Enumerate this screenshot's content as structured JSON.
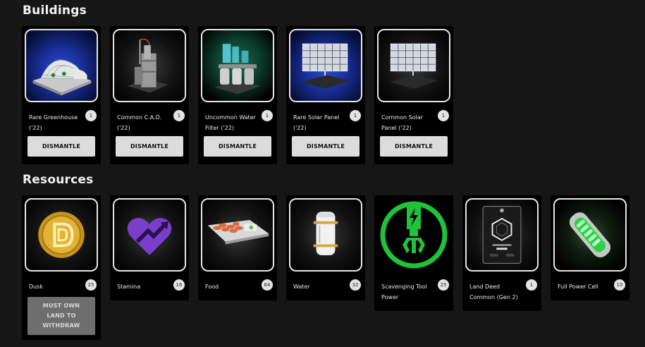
{
  "sections": {
    "buildings_title": "Buildings",
    "resources_title": "Resources"
  },
  "buildings": [
    {
      "name": "Rare Greenhouse ('22)",
      "count": "1",
      "action": "DISMANTLE",
      "icon": "greenhouse-icon"
    },
    {
      "name": "Common C.A.D. ('22)",
      "count": "1",
      "action": "DISMANTLE",
      "icon": "cad-tower-icon"
    },
    {
      "name": "Uncommon Water Filter ('22)",
      "count": "1",
      "action": "DISMANTLE",
      "icon": "water-filter-icon"
    },
    {
      "name": "Rare Solar Panel ('22)",
      "count": "1",
      "action": "DISMANTLE",
      "icon": "solar-panel-icon"
    },
    {
      "name": "Common Solar Panel ('22)",
      "count": "1",
      "action": "DISMANTLE",
      "icon": "solar-panel-icon"
    }
  ],
  "resources": [
    {
      "name": "Dusk",
      "count": "25",
      "action": "MUST OWN LAND TO WITHDRAW",
      "icon": "dusk-coin-icon"
    },
    {
      "name": "Stamina",
      "count": "16",
      "icon": "stamina-heart-icon"
    },
    {
      "name": "Food",
      "count": "64",
      "icon": "food-tray-icon"
    },
    {
      "name": "Water",
      "count": "32",
      "icon": "water-canister-icon"
    },
    {
      "name": "Scavenging Tool Power",
      "count": "25",
      "icon": "scavenging-claw-icon"
    },
    {
      "name": "Land Deed Common (Gen 2)",
      "count": "1",
      "icon": "land-deed-icon"
    },
    {
      "name": "Full Power Cell",
      "count": "10",
      "icon": "power-cell-icon"
    }
  ],
  "colors": {
    "background": "#161616",
    "card": "#000000",
    "button": "#dcdcdc",
    "button_disabled": "#6e6e6e",
    "scavenging_green": "#1fc33a"
  }
}
